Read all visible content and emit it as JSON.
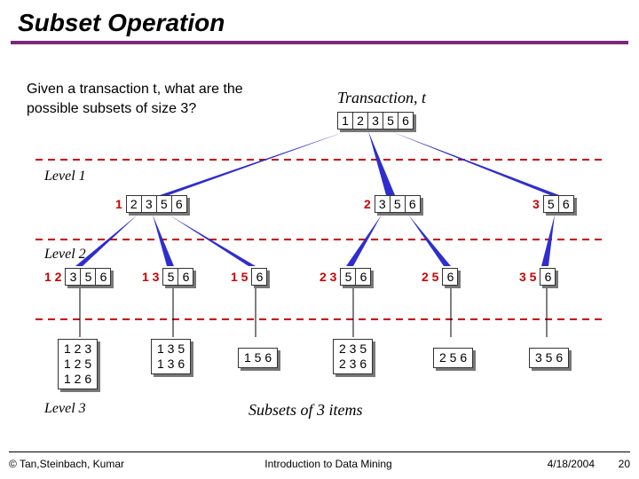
{
  "title": "Subset Operation",
  "question": "Given a transaction t, what are the possible subsets of size 3?",
  "labels": {
    "transaction": "Transaction, t",
    "level1": "Level 1",
    "level2": "Level 2",
    "level3": "Level 3",
    "subsets": "Subsets of 3 items"
  },
  "root": {
    "cells": [
      "1",
      "2",
      "3",
      "5",
      "6"
    ]
  },
  "level1_nodes": [
    {
      "prefix": "1",
      "cells": [
        "2",
        "3",
        "5",
        "6"
      ]
    },
    {
      "prefix": "2",
      "cells": [
        "3",
        "5",
        "6"
      ]
    },
    {
      "prefix": "3",
      "cells": [
        "5",
        "6"
      ]
    }
  ],
  "level2_nodes": [
    {
      "prefix": "1 2",
      "cells": [
        "3",
        "5",
        "6"
      ]
    },
    {
      "prefix": "1 3",
      "cells": [
        "5",
        "6"
      ]
    },
    {
      "prefix": "1 5",
      "cells": [
        "6"
      ]
    },
    {
      "prefix": "2 3",
      "cells": [
        "5",
        "6"
      ]
    },
    {
      "prefix": "2 5",
      "cells": [
        "6"
      ]
    },
    {
      "prefix": "3 5",
      "cells": [
        "6"
      ]
    }
  ],
  "leaves": [
    "1 2 3\n1 2 5\n1 2 6",
    "1 3 5\n1 3 6",
    "1 5 6",
    "2 3 5\n2 3 6",
    "2 5 6",
    "3 5 6"
  ],
  "footer": {
    "copyright": "© Tan,Steinbach, Kumar",
    "center": "Introduction to Data Mining",
    "date": "4/18/2004",
    "page": "20"
  }
}
